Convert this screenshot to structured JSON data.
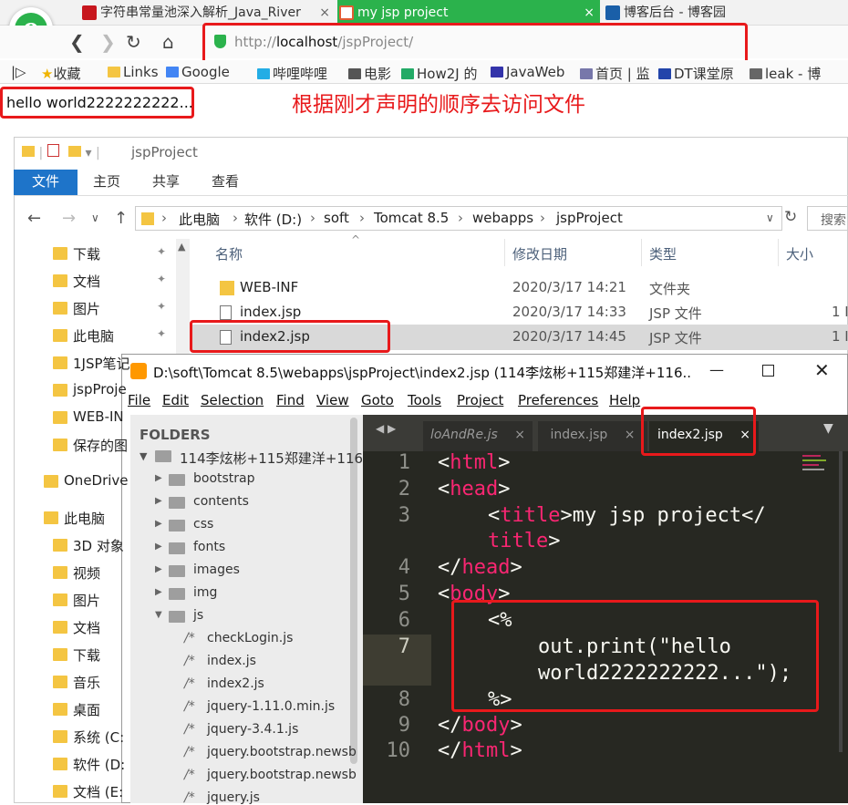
{
  "browser": {
    "tabs": [
      {
        "label": "字符串常量池深入解析_Java_River",
        "favicon_color": "#c7161d"
      },
      {
        "label": "my jsp project",
        "favicon_color": "#e25c33"
      },
      {
        "label": "博客后台 - 博客园",
        "favicon_color": "#1a5fa8"
      }
    ],
    "address": {
      "scheme": "http://",
      "host": "localhost",
      "path": "/jspProject/"
    },
    "bookmarks": [
      "收藏",
      "Links",
      "Google",
      "哔哩哔哩",
      "电影",
      "How2J 的",
      "JavaWeb",
      "首页 | 监",
      "DT课堂原",
      "leak - 博"
    ],
    "page_output": "hello world2222222222...",
    "annotation": "根据刚才声明的顺序去访问文件",
    "accent_color": "#e8191b"
  },
  "explorer": {
    "title": "jspProject",
    "ribbon": [
      "文件",
      "主页",
      "共享",
      "查看"
    ],
    "breadcrumb": [
      "此电脑",
      "软件 (D:)",
      "soft",
      "Tomcat 8.5",
      "webapps",
      "jspProject"
    ],
    "search_placeholder": "搜索",
    "nav": [
      "下载",
      "文档",
      "图片",
      "此电脑",
      "1JSP笔记",
      "jspProje",
      "WEB-IN",
      "保存的图",
      "OneDrive",
      "此电脑",
      "3D 对象",
      "视频",
      "图片",
      "文档",
      "下载",
      "音乐",
      "桌面",
      "系统 (C:",
      "软件 (D:",
      "文档 (E:"
    ],
    "columns": {
      "name": "名称",
      "date": "修改日期",
      "type": "类型",
      "size": "大小"
    },
    "files": [
      {
        "name": "WEB-INF",
        "date": "2020/3/17 14:21",
        "type": "文件夹",
        "size": ""
      },
      {
        "name": "index.jsp",
        "date": "2020/3/17 14:33",
        "type": "JSP 文件",
        "size": "1 I"
      },
      {
        "name": "index2.jsp",
        "date": "2020/3/17 14:45",
        "type": "JSP 文件",
        "size": "1 I"
      }
    ]
  },
  "sublime": {
    "title": "D:\\soft\\Tomcat 8.5\\webapps\\jspProject\\index2.jsp (114李炫彬+115郑建洋+116...",
    "menu": [
      "File",
      "Edit",
      "Selection",
      "Find",
      "View",
      "Goto",
      "Tools",
      "Project",
      "Preferences",
      "Help"
    ],
    "folders_header": "FOLDERS",
    "root_folder": "114李炫彬+115郑建洋+116",
    "folders": [
      "bootstrap",
      "contents",
      "css",
      "fonts",
      "images",
      "img",
      "js"
    ],
    "js_files": [
      "checkLogin.js",
      "index.js",
      "index2.js",
      "jquery-1.11.0.min.js",
      "jquery-3.4.1.js",
      "jquery.bootstrap.newsb",
      "jquery.bootstrap.newsb",
      "jquery.js"
    ],
    "tabs": [
      "loAndRe.js",
      "index.jsp",
      "index2.jsp"
    ],
    "line_numbers": [
      "1",
      "2",
      "3",
      "4",
      "5",
      "6",
      "7",
      "8",
      "9",
      "10"
    ],
    "code": {
      "l1_tag": "html",
      "l2_tag": "head",
      "l3_tag": "title",
      "l3_text": "my jsp project</",
      "l3b_tag": "title",
      "l4_tag": "head",
      "l5_tag": "body",
      "l6": "<%",
      "l7a": "out.print(\"hello",
      "l7b": "world2222222222...\");",
      "l8": "%>",
      "l9_tag": "body",
      "l10_tag": "html"
    }
  }
}
